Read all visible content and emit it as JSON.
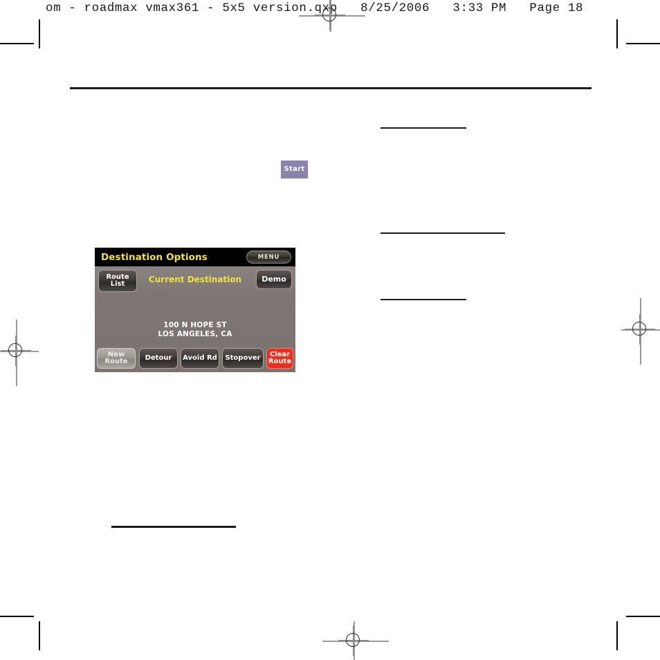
{
  "page": {
    "slug_line": "om - roadmax vmax361 - 5x5 version.qxp   8/25/2006   3:33 PM   Page 18",
    "page_number": "Page 18",
    "document_name": "roadmax vmax361 - 5x5 version.qxp",
    "date": "8/25/2006",
    "time": "3:33 PM"
  },
  "start_button": {
    "label": "Start",
    "color": "#8b82ad"
  },
  "gps": {
    "title": "Destination Options",
    "title_color": "#f2e23c",
    "menu_button": "MENU",
    "route_list_button": "Route\nList",
    "route_list_line1": "Route",
    "route_list_line2": "List",
    "demo_button": "Demo",
    "current_destination_label": "Current Destination",
    "destination": {
      "street": "100 N HOPE ST",
      "city_state": "LOS ANGELES, CA"
    },
    "bottom_buttons": [
      {
        "name": "new-route",
        "line1": "New",
        "line2": "Route",
        "state": "disabled"
      },
      {
        "name": "detour",
        "line1": "Detour",
        "line2": "",
        "state": "enabled"
      },
      {
        "name": "avoid-rd",
        "line1": "Avoid Rd",
        "line2": "",
        "state": "enabled"
      },
      {
        "name": "stopover",
        "line1": "Stopover",
        "line2": "",
        "state": "enabled"
      },
      {
        "name": "clear-route",
        "line1": "Clear",
        "line2": "Route",
        "state": "danger"
      }
    ],
    "colors": {
      "screen_background": "#7d7673",
      "titlebar_background": "#000000",
      "accent_yellow": "#f2e23c",
      "danger_red": "#ef2d1e"
    }
  }
}
